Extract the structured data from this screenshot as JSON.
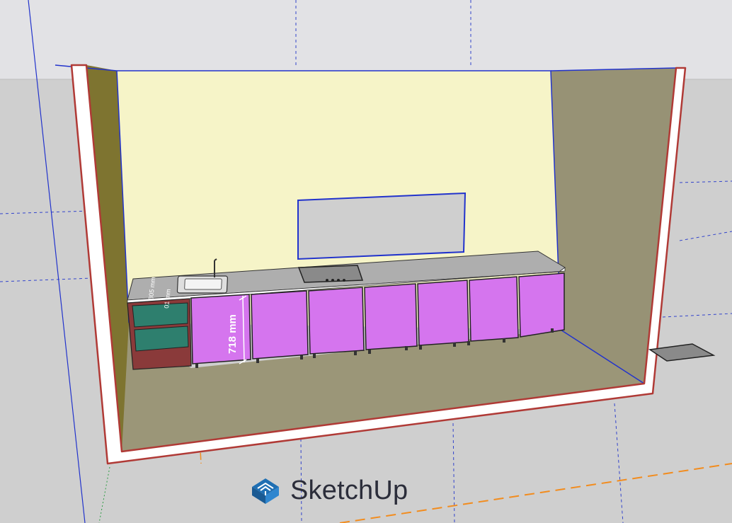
{
  "app": {
    "watermark_text": "SketchUp",
    "logo_icon": "sketchup-logo-icon"
  },
  "dimensions": {
    "cabinet_height_label": "718 mm",
    "side_label_1": "305 mm",
    "side_label_2": "01 mm"
  },
  "colors": {
    "sky": "#e2e2e5",
    "ground": "#cfcfcf",
    "back_wall": "#f6f4c8",
    "side_wall_left": "#7e7430",
    "side_wall_right": "#979275",
    "floor": "#9b9678",
    "wall_cut_outline": "#b03a36",
    "wall_cut_fill": "#ffffff",
    "cabinet_door": "#d575ee",
    "shelf_green": "#2e7f6e",
    "shelf_back": "#8a3a3a",
    "countertop": "#aeaeae",
    "axis_blue": "#2233cc",
    "axis_orange": "#f28c1e",
    "axis_green": "#2c9c43"
  },
  "icons": [
    "sketchup-logo-icon",
    "kitchen-sink-icon",
    "faucet-icon",
    "cooktop-icon",
    "floor-mat-icon"
  ]
}
